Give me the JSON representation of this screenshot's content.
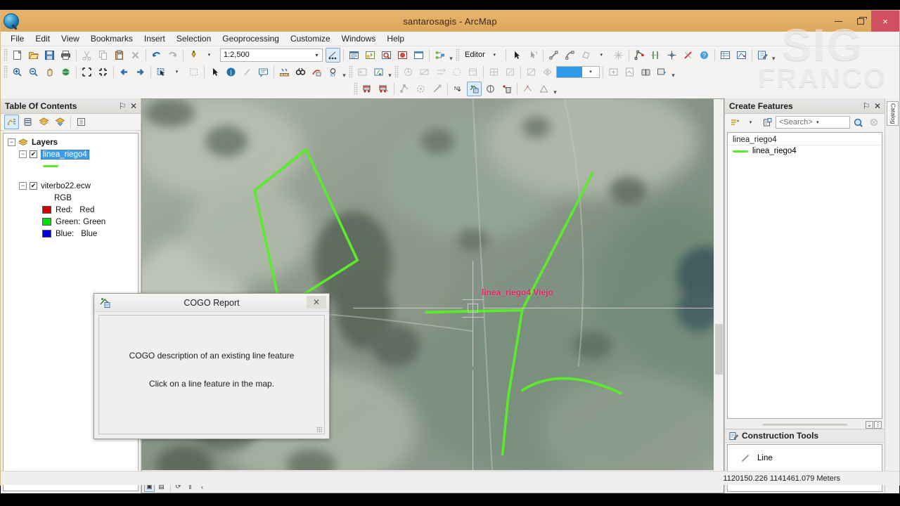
{
  "window": {
    "title": "santarosagis - ArcMap",
    "app_icon": "arcmap-globe-icon",
    "minimize": "–",
    "restore": "□",
    "close": "×"
  },
  "menubar": {
    "items": [
      {
        "label": "File"
      },
      {
        "label": "Edit"
      },
      {
        "label": "View"
      },
      {
        "label": "Bookmarks"
      },
      {
        "label": "Insert"
      },
      {
        "label": "Selection"
      },
      {
        "label": "Geoprocessing"
      },
      {
        "label": "Customize"
      },
      {
        "label": "Windows"
      },
      {
        "label": "Help"
      }
    ]
  },
  "toolbars": {
    "standard": {
      "scale_value": "1:2,500",
      "items": [
        "new-document-icon",
        "open-folder-icon",
        "save-icon",
        "print-icon",
        "cut-icon",
        "copy-icon",
        "paste-icon",
        "delete-icon",
        "undo-icon",
        "redo-icon",
        "add-data-icon"
      ]
    },
    "editor": {
      "label": "Editor",
      "dropdown_arrow": "▾",
      "items": [
        "edit-tool-icon",
        "edit-annotation-icon",
        "straight-segment-icon",
        "arc-segment-icon",
        "trace-icon",
        "midpoint-icon",
        "construct-geometry-icon",
        "split-icon",
        "rotate-icon",
        "cut-polygon-icon",
        "undo-edit-icon",
        "attributes-icon",
        "sketch-properties-icon",
        "create-features-icon"
      ]
    },
    "effects": {
      "transparency_color": "#2e9be8",
      "dropdown_arrow": "▾"
    },
    "cogo": {
      "items": [
        "cogo-traverse-icon",
        "cogo-traverse2-icon",
        "update-cogo-icon",
        "proportion-icon",
        "cogo-area-icon",
        "direction-offset-icon",
        "cogo-report-icon",
        "curve-icon",
        "cogo-dimension-icon",
        "cogo-divide-icon",
        "cogo-tangent-icon"
      ],
      "active_item": "cogo-report-icon"
    }
  },
  "table_of_contents": {
    "title": "Table Of Contents",
    "pin": "⚐",
    "close": "✕",
    "toolbar_items": [
      "list-by-drawing-order-icon",
      "list-by-source-icon",
      "list-by-visibility-icon",
      "list-by-selection-icon",
      "options-icon"
    ],
    "tree": {
      "root": {
        "label": "Layers",
        "expander": "−",
        "icon": "layers-icon"
      },
      "layers": [
        {
          "label": "linea_riego4",
          "checked": true,
          "check_glyph": "✔",
          "expander": "−",
          "selected": true,
          "symbol": "green-line-symbol",
          "symbol_color": "#5aec2a"
        },
        {
          "label": "viterbo22.ecw",
          "checked": true,
          "check_glyph": "✔",
          "expander": "−",
          "selected": false,
          "sublabel": "RGB",
          "bands": [
            {
              "label": "Red:",
              "value": "Red",
              "color": "#d70000"
            },
            {
              "label": "Green:",
              "value": "Green",
              "color": "#00dd00"
            },
            {
              "label": "Blue:",
              "value": "Blue",
              "color": "#0000e0"
            }
          ]
        }
      ]
    }
  },
  "map": {
    "label": "linea_riego4 Viejo",
    "label_color": "#e0245e",
    "feature_color": "#5aec2a",
    "cursor": "crosshair-cursor",
    "bottom_bar": {
      "items": [
        {
          "name": "data-view-button",
          "glyph": "▣",
          "active": true
        },
        {
          "name": "layout-view-button",
          "glyph": "▤",
          "active": false
        },
        {
          "name": "refresh-button",
          "glyph": "⟳",
          "active": false
        },
        {
          "name": "pause-drawing-button",
          "glyph": "‖",
          "active": false
        },
        {
          "name": "previous-extent-button",
          "glyph": "‹",
          "active": false
        }
      ]
    },
    "scroll_right_arrow": "›"
  },
  "create_features": {
    "title": "Create Features",
    "pin": "⚐",
    "close": "✕",
    "search_placeholder": "<Search>",
    "search_value": "",
    "dropdown_arrow": "▾",
    "search_icon": "search-icon",
    "clear_icon": "clear-search-icon",
    "templates_icon": "organize-templates-icon",
    "new_template_icon": "new-template-icon",
    "group_label": "linea_riego4",
    "templates": [
      {
        "label": "linea_riego4",
        "symbol_color": "#5aec2a"
      }
    ],
    "splitter": {
      "collapse_glyph": "⌄",
      "options_glyph": "⋮"
    },
    "construction_tools": {
      "title": "Construction Tools",
      "icon": "construction-tools-icon",
      "tools": [
        {
          "label": "Line",
          "icon": "line-tool-icon"
        }
      ]
    }
  },
  "dock_tabs": [
    {
      "label": "Catalog",
      "icon": "catalog-icon"
    }
  ],
  "cogo_dialog": {
    "title": "COGO Report",
    "icon": "cogo-report-icon",
    "close": "✕",
    "line1": "COGO description of an existing line feature",
    "line2": "Click on a line feature in the map."
  },
  "status_bar": {
    "coordinates": "1120150.226  1141461.079 Meters"
  },
  "watermark": {
    "line1": "SIG",
    "line2": "FRANCO"
  }
}
